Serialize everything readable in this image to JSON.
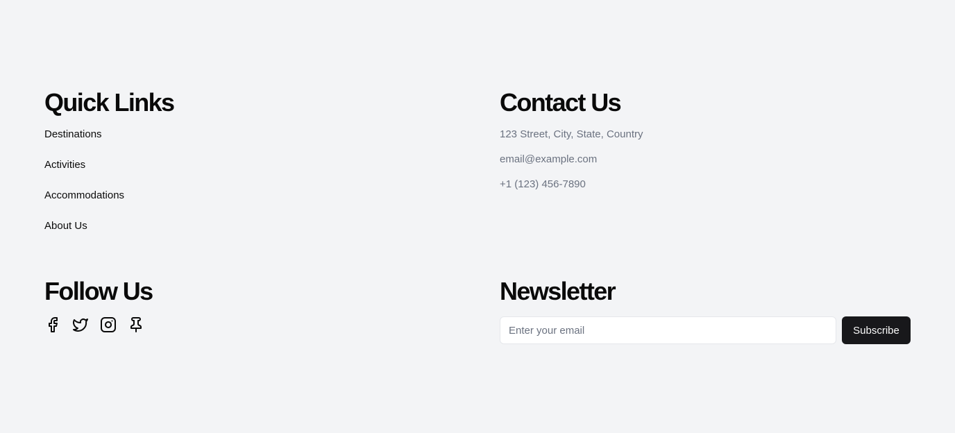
{
  "quick_links": {
    "title": "Quick Links",
    "items": [
      {
        "label": "Destinations"
      },
      {
        "label": "Activities"
      },
      {
        "label": "Accommodations"
      },
      {
        "label": "About Us"
      }
    ]
  },
  "contact": {
    "title": "Contact Us",
    "address": "123 Street, City, State, Country",
    "email": "email@example.com",
    "phone": "+1 (123) 456-7890"
  },
  "follow": {
    "title": "Follow Us",
    "icons": [
      "facebook-icon",
      "twitter-icon",
      "instagram-icon",
      "pin-icon"
    ]
  },
  "newsletter": {
    "title": "Newsletter",
    "input_placeholder": "Enter your email",
    "input_value": "",
    "button_label": "Subscribe"
  },
  "colors": {
    "background": "#f3f4f6",
    "heading": "#0a0a0a",
    "muted_text": "#6b7280",
    "button_bg": "#18181b",
    "button_text": "#fafafa"
  }
}
